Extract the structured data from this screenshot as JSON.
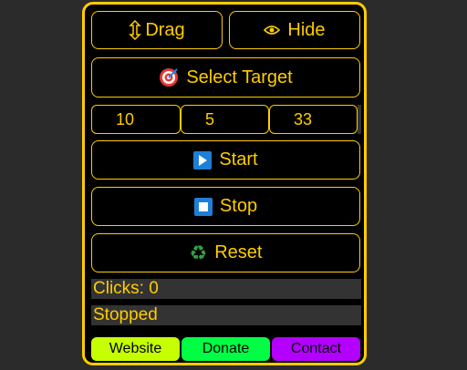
{
  "controls": {
    "drag_label": "Drag",
    "hide_label": "Hide",
    "select_target_label": "Select Target",
    "start_label": "Start",
    "stop_label": "Stop",
    "reset_label": "Reset"
  },
  "inputs": {
    "field1": "10",
    "field2": "5",
    "field3": "33"
  },
  "status": {
    "clicks_text": "Clicks: 0",
    "state_text": "Stopped"
  },
  "links": {
    "website": "Website",
    "donate": "Donate",
    "contact": "Contact"
  },
  "colors": {
    "accent": "#ffcc00",
    "background": "#2b2b2b",
    "panel": "#000000",
    "website_bg": "#c6ff00",
    "donate_bg": "#00ff44",
    "contact_bg": "#b300ff"
  },
  "icons": {
    "drag": "up-down-arrow-icon",
    "hide": "eye-icon",
    "select_target": "target-icon",
    "start": "play-icon",
    "stop": "stop-icon",
    "reset": "recycle-icon"
  }
}
